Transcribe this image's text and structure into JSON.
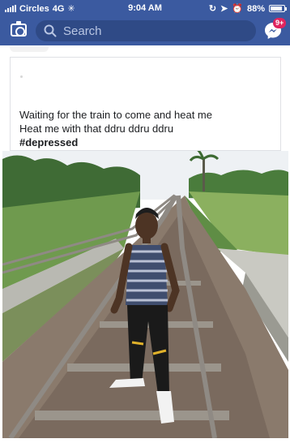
{
  "status_bar": {
    "carrier": "Circles",
    "network": "4G",
    "time": "9:04 AM",
    "battery": "88%",
    "battery_level": 0.88
  },
  "header": {
    "search_placeholder": "Search",
    "camera_icon": "camera-icon",
    "messenger_icon": "messenger-icon",
    "notification_count": "9+"
  },
  "post": {
    "lines": [
      "Waiting for the train to come and heat me",
      "Heat me with that ddru ddru ddru"
    ],
    "hashtag": "#depressed",
    "photo_alt": "photo"
  },
  "colors": {
    "brand_blue": "#3b5aa0",
    "badge_red": "#e0245e"
  }
}
